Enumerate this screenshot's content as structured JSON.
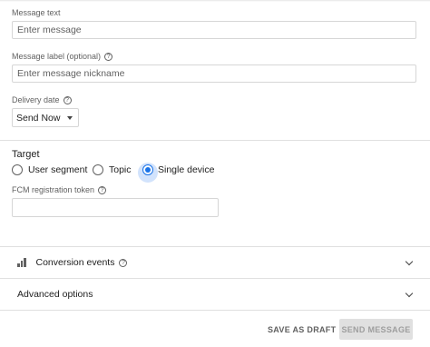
{
  "message_text": {
    "label": "Message text",
    "placeholder": "Enter message"
  },
  "message_label": {
    "label": "Message label (optional)",
    "placeholder": "Enter message nickname"
  },
  "delivery_date": {
    "label": "Delivery date",
    "value": "Send Now"
  },
  "target": {
    "title": "Target",
    "options": [
      {
        "label": "User segment",
        "selected": false
      },
      {
        "label": "Topic",
        "selected": false
      },
      {
        "label": "Single device",
        "selected": true
      }
    ],
    "token_label": "FCM registration token",
    "token_value": ""
  },
  "conversion_events": {
    "label": "Conversion events",
    "icon": "bar-chart-icon"
  },
  "advanced_options": {
    "label": "Advanced options"
  },
  "footer": {
    "draft_label": "SAVE AS DRAFT",
    "send_label": "SEND MESSAGE"
  },
  "colors": {
    "accent": "#1a73e8",
    "halo": "#d2e3fc"
  }
}
